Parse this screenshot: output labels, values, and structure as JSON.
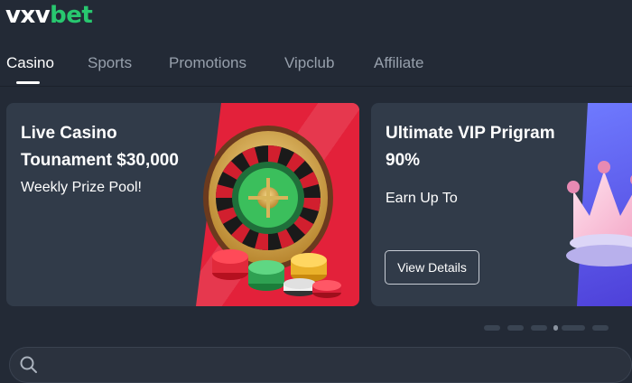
{
  "brand": {
    "logo_part1": "vxv",
    "logo_part2": "bet"
  },
  "nav": {
    "tabs": [
      {
        "label": "Casino",
        "active": true
      },
      {
        "label": "Sports",
        "active": false
      },
      {
        "label": "Promotions",
        "active": false
      },
      {
        "label": "Vipclub",
        "active": false
      },
      {
        "label": "Affiliate",
        "active": false
      }
    ]
  },
  "banners": [
    {
      "title_line1": "Live Casino",
      "title_line2": "Tounament $30,000",
      "subtitle": "Weekly Prize Pool!",
      "art_icon": "roulette-wheel-icon",
      "accent": "#e3213a"
    },
    {
      "title_line1": "Ultimate VIP Prigram",
      "title_line2": "90%",
      "subtitle": "Earn Up To",
      "button_label": "View Details",
      "art_icon": "crown-icon",
      "accent": "#5b5cf0"
    }
  ],
  "carousel": {
    "count": 6,
    "active_index": 3
  },
  "colors": {
    "background": "#232a36",
    "card": "#313b49",
    "brand_green": "#28c76f"
  }
}
